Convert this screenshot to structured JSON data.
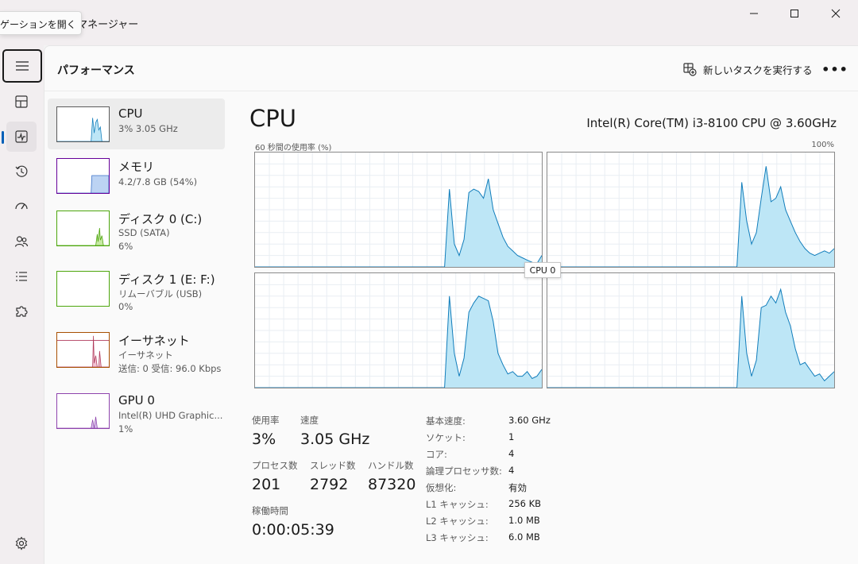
{
  "window": {
    "title_partial": "ク マネージャー",
    "tooltip": "ゲーションを開く"
  },
  "header": {
    "page_title": "パフォーマンス",
    "run_task_label": "新しいタスクを実行する",
    "more_label": "•••"
  },
  "devices": [
    {
      "name": "CPU",
      "sub1": "3% 3.05 GHz",
      "sub2": "",
      "color": "#117dbb"
    },
    {
      "name": "メモリ",
      "sub1": "4.2/7.8 GB (54%)",
      "sub2": "",
      "color": "#660099",
      "fill": 0.54
    },
    {
      "name": "ディスク 0 (C:)",
      "sub1": "SSD (SATA)",
      "sub2": "6%",
      "color": "#4da60c"
    },
    {
      "name": "ディスク 1 (E: F:)",
      "sub1": "リムーバブル (USB)",
      "sub2": "0%",
      "color": "#4da60c"
    },
    {
      "name": "イーサネット",
      "sub1": "イーサネット",
      "sub2": "送信: 0 受信: 96.0 Kbps",
      "color": "#a74f01"
    },
    {
      "name": "GPU 0",
      "sub1": "Intel(R) UHD Graphic...",
      "sub2": "1%",
      "color": "#8e44ad"
    }
  ],
  "cpu": {
    "title": "CPU",
    "model": "Intel(R) Core(TM) i3-8100 CPU @ 3.60GHz",
    "axis_left": "60 秒間の使用率 (%)",
    "axis_right": "100%",
    "tooltip": "CPU 0",
    "stats": {
      "usage_label": "使用率",
      "usage_value": "3%",
      "speed_label": "速度",
      "speed_value": "3.05 GHz",
      "process_label": "プロセス数",
      "process_value": "201",
      "thread_label": "スレッド数",
      "thread_value": "2792",
      "handle_label": "ハンドル数",
      "handle_value": "87320",
      "uptime_label": "稼働時間",
      "uptime_value": "0:00:05:39"
    },
    "specs": [
      {
        "key": "基本速度:",
        "value": "3.60 GHz"
      },
      {
        "key": "ソケット:",
        "value": "1"
      },
      {
        "key": "コア:",
        "value": "4"
      },
      {
        "key": "論理プロセッサ数:",
        "value": "4"
      },
      {
        "key": "仮想化:",
        "value": "有効"
      },
      {
        "key": "L1 キャッシュ:",
        "value": "256 KB"
      },
      {
        "key": "L2 キャッシュ:",
        "value": "1.0 MB"
      },
      {
        "key": "L3 キャッシュ:",
        "value": "6.0 MB"
      }
    ]
  },
  "chart_data": {
    "type": "area",
    "x_range_seconds": 60,
    "ylim": [
      0,
      100
    ],
    "grid": true,
    "series": [
      {
        "values": [
          0,
          0,
          0,
          0,
          0,
          0,
          0,
          0,
          0,
          0,
          0,
          0,
          0,
          0,
          0,
          0,
          0,
          0,
          0,
          0,
          0,
          0,
          0,
          0,
          0,
          0,
          0,
          0,
          0,
          0,
          0,
          0,
          0,
          0,
          0,
          0,
          0,
          0,
          0,
          0,
          68,
          20,
          10,
          24,
          65,
          68,
          66,
          60,
          77,
          50,
          38,
          26,
          18,
          14,
          10,
          8,
          6,
          4,
          3,
          10
        ]
      },
      {
        "values": [
          0,
          0,
          0,
          0,
          0,
          0,
          0,
          0,
          0,
          0,
          0,
          0,
          0,
          0,
          0,
          0,
          0,
          0,
          0,
          0,
          0,
          0,
          0,
          0,
          0,
          0,
          0,
          0,
          0,
          0,
          0,
          0,
          0,
          0,
          0,
          0,
          0,
          0,
          0,
          0,
          74,
          40,
          20,
          30,
          60,
          88,
          57,
          60,
          70,
          50,
          40,
          30,
          22,
          16,
          12,
          10,
          12,
          14,
          12,
          16
        ]
      },
      {
        "values": [
          0,
          0,
          0,
          0,
          0,
          0,
          0,
          0,
          0,
          0,
          0,
          0,
          0,
          0,
          0,
          0,
          0,
          0,
          0,
          0,
          0,
          0,
          0,
          0,
          0,
          0,
          0,
          0,
          0,
          0,
          0,
          0,
          0,
          0,
          0,
          0,
          0,
          0,
          0,
          0,
          80,
          30,
          10,
          26,
          66,
          74,
          80,
          78,
          76,
          58,
          30,
          20,
          12,
          14,
          10,
          10,
          14,
          8,
          10,
          16
        ]
      },
      {
        "values": [
          0,
          0,
          0,
          0,
          0,
          0,
          0,
          0,
          0,
          0,
          0,
          0,
          0,
          0,
          0,
          0,
          0,
          0,
          0,
          0,
          0,
          0,
          0,
          0,
          0,
          0,
          0,
          0,
          0,
          0,
          0,
          0,
          0,
          0,
          0,
          0,
          0,
          0,
          0,
          0,
          80,
          30,
          10,
          24,
          70,
          72,
          80,
          74,
          86,
          66,
          54,
          34,
          20,
          22,
          16,
          10,
          12,
          6,
          10,
          14
        ]
      }
    ]
  },
  "colors": {
    "accent": "#005fb8",
    "cpu_line": "#117dbb",
    "cpu_fill": "#bde6f6",
    "grid": "#e9eef3"
  }
}
